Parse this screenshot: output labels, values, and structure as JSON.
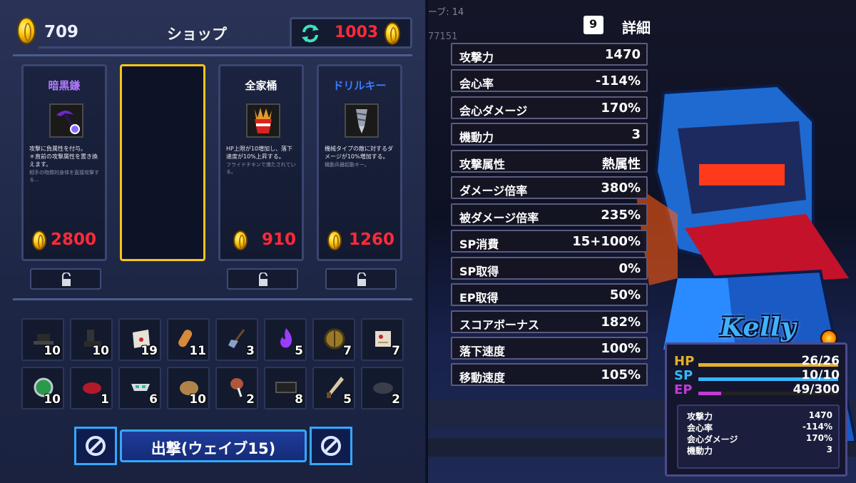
{
  "shop": {
    "gold": "709",
    "title": "ショップ",
    "reroll_cost": "1003",
    "cards": [
      {
        "name": "暗黒鎌",
        "name_color": "#b07bff",
        "desc": "攻撃に負属性を付与。\n＊直前の攻撃属性を置き換えます。",
        "flavor": "相手の物質的身体を直接攻撃する...",
        "price": "2800",
        "icon": "dark-scythe-icon"
      },
      {
        "name": "",
        "empty": true
      },
      {
        "name": "全家桶",
        "name_color": "#ffffff",
        "desc": "HP上限が10増加し、落下速度が10%上昇する。",
        "flavor": "フライドチキンで満たされている。",
        "price": "910",
        "icon": "fried-chicken-bucket-icon"
      },
      {
        "name": "ドリルキー",
        "name_color": "#3a7bff",
        "desc": "機械タイプの敵に対するダメージが10%増加する。",
        "flavor": "機動兵器起動キー。",
        "price": "1260",
        "icon": "drill-key-icon"
      }
    ],
    "inventory": [
      {
        "icon": "black-hat-icon",
        "qty": "10"
      },
      {
        "icon": "black-boots-icon",
        "qty": "10"
      },
      {
        "icon": "letter-icon",
        "qty": "19"
      },
      {
        "icon": "bread-icon",
        "qty": "11"
      },
      {
        "icon": "shovel-icon",
        "qty": "3"
      },
      {
        "icon": "purple-flame-icon",
        "qty": "5"
      },
      {
        "icon": "bronze-shield-icon",
        "qty": "7"
      },
      {
        "icon": "map-scroll-icon",
        "qty": "7"
      },
      {
        "icon": "green-orb-icon",
        "qty": "10"
      },
      {
        "icon": "red-steak-icon",
        "qty": "1"
      },
      {
        "icon": "mask-icon",
        "qty": "6"
      },
      {
        "icon": "potato-icon",
        "qty": "10"
      },
      {
        "icon": "drumstick-icon",
        "qty": "2"
      },
      {
        "icon": "black-box-icon",
        "qty": "8"
      },
      {
        "icon": "knife-icon",
        "qty": "5"
      },
      {
        "icon": "dark-stone-icon",
        "qty": "2"
      }
    ],
    "sortie_label": "出撃(ウェイブ15)"
  },
  "detail": {
    "key": "9",
    "label": "詳細",
    "wave_ghost": "ーブ: 14",
    "score_ghost": "77151",
    "stats": [
      {
        "k": "攻撃力",
        "v": "1470"
      },
      {
        "k": "会心率",
        "v": "-114%"
      },
      {
        "k": "会心ダメージ",
        "v": "170%"
      },
      {
        "k": "機動力",
        "v": "3"
      },
      {
        "k": "攻撃属性",
        "v": "熱属性"
      },
      {
        "k": "ダメージ倍率",
        "v": "380%"
      },
      {
        "k": "被ダメージ倍率",
        "v": "235%"
      },
      {
        "k": "SP消費",
        "v": "15+100%"
      },
      {
        "k": "SP取得",
        "v": "0%"
      },
      {
        "k": "EP取得",
        "v": "50%"
      },
      {
        "k": "スコアボーナス",
        "v": "182%"
      },
      {
        "k": "落下速度",
        "v": "100%"
      },
      {
        "k": "移動速度",
        "v": "105%"
      }
    ]
  },
  "character": {
    "name": "Kelly",
    "hp_label": "HP",
    "hp": "26/26",
    "hp_fraction": 1.0,
    "hp_color": "#e3b02e",
    "sp_label": "SP",
    "sp": "10/10",
    "sp_fraction": 1.0,
    "sp_color": "#35b8ff",
    "ep_label": "EP",
    "ep": "49/300",
    "ep_fraction": 0.163,
    "ep_color": "#c23ad6",
    "mini_stats": [
      {
        "k": "攻撃力",
        "v": "1470"
      },
      {
        "k": "会心率",
        "v": "-114%"
      },
      {
        "k": "会心ダメージ",
        "v": "170%"
      },
      {
        "k": "機動力",
        "v": "3"
      }
    ]
  }
}
